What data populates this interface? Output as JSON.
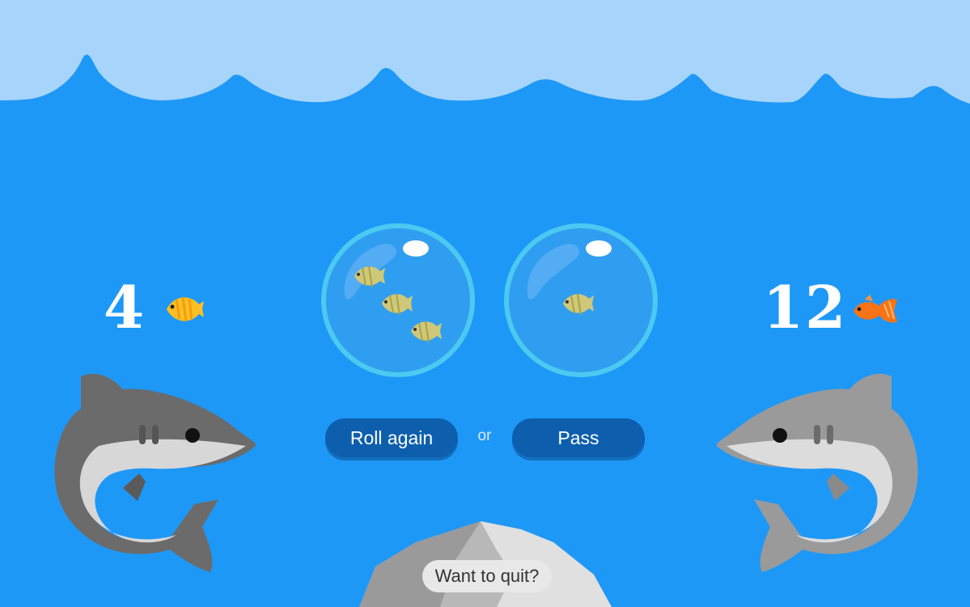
{
  "game": {
    "player_left": {
      "score": "4",
      "fish_icon": "tropical-fish-yellow-icon"
    },
    "player_right": {
      "score": "12",
      "fish_icon": "goldfish-orange-icon"
    },
    "dice": [
      {
        "fish_count": 3
      },
      {
        "fish_count": 1
      }
    ]
  },
  "controls": {
    "roll_label": "Roll again",
    "or_label": "or",
    "pass_label": "Pass",
    "quit_label": "Want to quit?"
  },
  "colors": {
    "water": "#1e98f7",
    "sky": "#a6d4fb",
    "button": "#0d5fae",
    "shark_dark": "#6e6e6e",
    "shark_light": "#9a9a9a"
  }
}
